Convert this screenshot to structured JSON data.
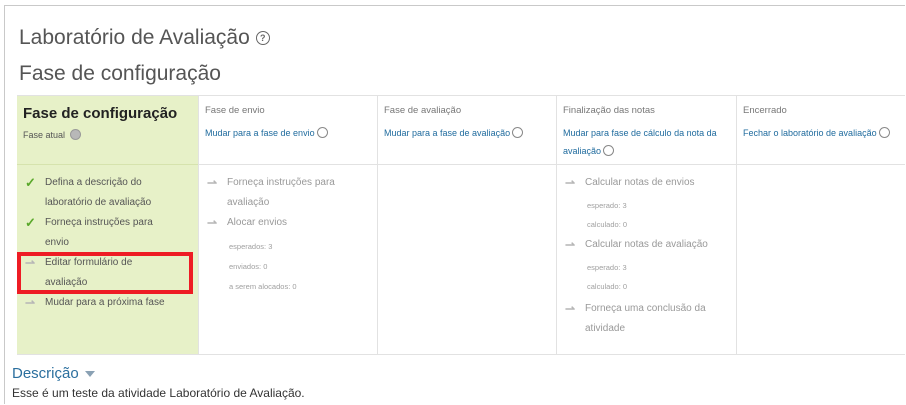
{
  "page": {
    "title": "Laboratório de Avaliação",
    "subtitle": "Fase de configuração"
  },
  "phases": [
    {
      "name": "Fase de configuração",
      "current_label": "Fase atual",
      "tasks": [
        {
          "text_lines": [
            "Defina a descrição do",
            "laboratório de avaliação"
          ],
          "done": true
        },
        {
          "text_lines": [
            "Forneça instruções para",
            "envio"
          ],
          "done": true
        },
        {
          "text_lines": [
            "Editar formulário de",
            "avaliação"
          ],
          "done": false
        },
        {
          "text_lines": [
            "Mudar para a próxima fase"
          ],
          "done": false
        }
      ]
    },
    {
      "name": "Fase de envio",
      "switch_lines": [
        "Mudar para a fase de envio"
      ],
      "tasks": [
        {
          "text_lines": [
            "Forneça instruções para",
            "avaliação"
          ],
          "done": false
        },
        {
          "text_lines": [
            "Alocar envios"
          ],
          "done": false
        }
      ],
      "details": [
        "esperados: 3",
        "enviados: 0",
        "a serem alocados: 0"
      ]
    },
    {
      "name": "Fase de avaliação",
      "switch_lines": [
        "Mudar para a fase de avaliação"
      ]
    },
    {
      "name": "Finalização das notas",
      "switch_lines": [
        "Mudar para fase de cálculo da nota da",
        "avaliação"
      ],
      "tasks": [
        {
          "text": "Calcular notas de envios",
          "done": false
        },
        {
          "text": "Calcular notas de avaliação",
          "done": false
        },
        {
          "text_lines": [
            "Forneça uma conclusão da",
            "atividade"
          ],
          "done": false
        }
      ],
      "details_submissions": [
        "esperado: 3",
        "calculado: 0"
      ],
      "details_assessments": [
        "esperado: 3",
        "calculado: 0"
      ]
    },
    {
      "name": "Encerrado",
      "switch_lines": [
        "Fechar o laboratório de avaliação"
      ]
    }
  ],
  "description": {
    "title": "Descrição",
    "text": "Esse é um teste da atividade Laboratório de Avaliação."
  },
  "icons": {
    "help": "question-circle-icon",
    "bulb": "lightbulb-icon",
    "done": "check-icon",
    "todo": "todo-check-icon",
    "collapse": "chevron-down-icon"
  },
  "colors": {
    "active_phase_bg": "#e7f1c8",
    "link": "#1f6b9e",
    "done_check": "#5aa82a",
    "highlight_border": "#ee1c24"
  }
}
